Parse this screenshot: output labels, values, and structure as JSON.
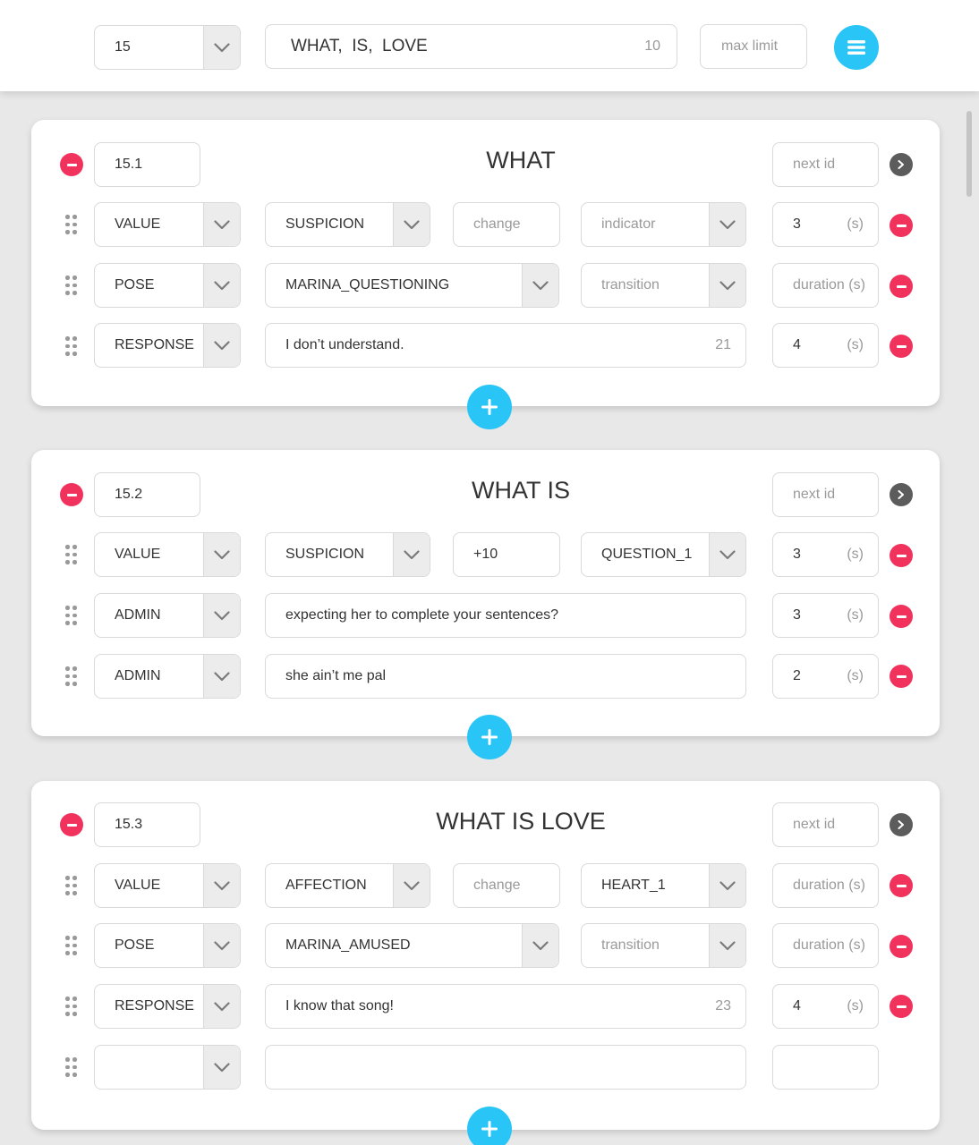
{
  "header": {
    "scene_value": "15",
    "title_value": "WHAT,  IS,  LOVE",
    "title_count": "10",
    "max_limit_placeholder": "max limit"
  },
  "cards": [
    {
      "id_value": "15.1",
      "title": "WHAT",
      "next_id_placeholder": "next id",
      "rows": [
        {
          "type": "VALUE",
          "stat": "SUSPICION",
          "change_placeholder": "change",
          "indicator_placeholder": "indicator",
          "duration": "3",
          "unit": "(s)"
        },
        {
          "type": "POSE",
          "pose": "MARINA_QUESTIONING",
          "transition_placeholder": "transition",
          "duration_placeholder": "duration (s)"
        },
        {
          "type": "RESPONSE",
          "text": "I don’t understand.",
          "count": "21",
          "duration": "4",
          "unit": "(s)"
        }
      ]
    },
    {
      "id_value": "15.2",
      "title": "WHAT IS",
      "next_id_placeholder": "next id",
      "rows": [
        {
          "type": "VALUE",
          "stat": "SUSPICION",
          "change": "+10",
          "indicator": "QUESTION_1",
          "duration": "3",
          "unit": "(s)"
        },
        {
          "type": "ADMIN",
          "text": "expecting her to complete your sentences?",
          "duration": "3",
          "unit": "(s)"
        },
        {
          "type": "ADMIN",
          "text": "she ain’t me pal",
          "duration": "2",
          "unit": "(s)"
        }
      ]
    },
    {
      "id_value": "15.3",
      "title": "WHAT IS LOVE",
      "next_id_placeholder": "next id",
      "rows": [
        {
          "type": "VALUE",
          "stat": "AFFECTION",
          "change_placeholder": "change",
          "indicator": "HEART_1",
          "duration_placeholder": "duration (s)"
        },
        {
          "type": "POSE",
          "pose": "MARINA_AMUSED",
          "transition_placeholder": "transition",
          "duration_placeholder": "duration (s)"
        },
        {
          "type": "RESPONSE",
          "text": "I know that song!",
          "count": "23",
          "duration": "4",
          "unit": "(s)"
        },
        {
          "type": "",
          "text": "",
          "duration": ""
        }
      ]
    }
  ],
  "colors": {
    "accent": "#29c5f6",
    "danger": "#f0325c",
    "next": "#5c5c5c"
  },
  "icons": [
    "chevron-down-icon",
    "hamburger-menu-icon",
    "minus-circle-icon",
    "arrow-right-circle-icon",
    "drag-handle-icon",
    "plus-icon"
  ]
}
